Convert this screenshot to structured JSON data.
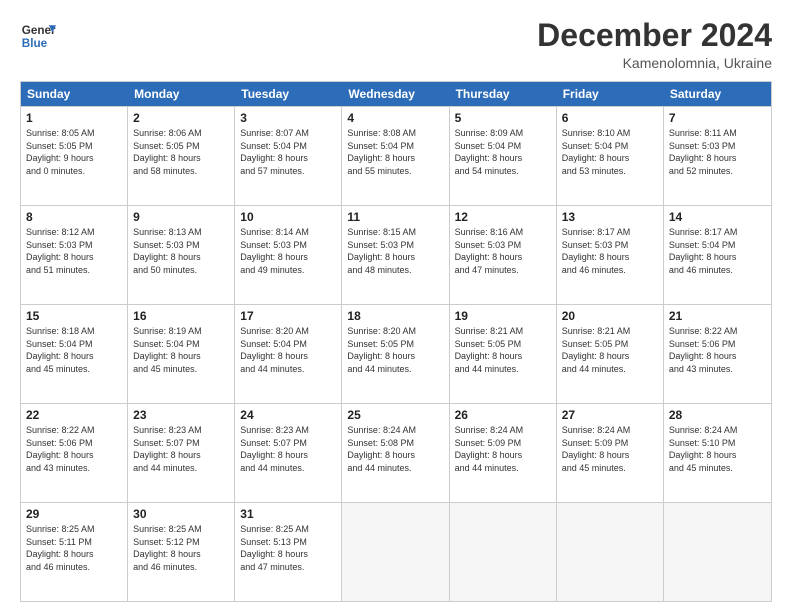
{
  "logo": {
    "line1": "General",
    "line2": "Blue"
  },
  "title": "December 2024",
  "subtitle": "Kamenolomnia, Ukraine",
  "days": [
    "Sunday",
    "Monday",
    "Tuesday",
    "Wednesday",
    "Thursday",
    "Friday",
    "Saturday"
  ],
  "weeks": [
    [
      {
        "day": "1",
        "info": "Sunrise: 8:05 AM\nSunset: 5:05 PM\nDaylight: 9 hours\nand 0 minutes."
      },
      {
        "day": "2",
        "info": "Sunrise: 8:06 AM\nSunset: 5:05 PM\nDaylight: 8 hours\nand 58 minutes."
      },
      {
        "day": "3",
        "info": "Sunrise: 8:07 AM\nSunset: 5:04 PM\nDaylight: 8 hours\nand 57 minutes."
      },
      {
        "day": "4",
        "info": "Sunrise: 8:08 AM\nSunset: 5:04 PM\nDaylight: 8 hours\nand 55 minutes."
      },
      {
        "day": "5",
        "info": "Sunrise: 8:09 AM\nSunset: 5:04 PM\nDaylight: 8 hours\nand 54 minutes."
      },
      {
        "day": "6",
        "info": "Sunrise: 8:10 AM\nSunset: 5:04 PM\nDaylight: 8 hours\nand 53 minutes."
      },
      {
        "day": "7",
        "info": "Sunrise: 8:11 AM\nSunset: 5:03 PM\nDaylight: 8 hours\nand 52 minutes."
      }
    ],
    [
      {
        "day": "8",
        "info": "Sunrise: 8:12 AM\nSunset: 5:03 PM\nDaylight: 8 hours\nand 51 minutes."
      },
      {
        "day": "9",
        "info": "Sunrise: 8:13 AM\nSunset: 5:03 PM\nDaylight: 8 hours\nand 50 minutes."
      },
      {
        "day": "10",
        "info": "Sunrise: 8:14 AM\nSunset: 5:03 PM\nDaylight: 8 hours\nand 49 minutes."
      },
      {
        "day": "11",
        "info": "Sunrise: 8:15 AM\nSunset: 5:03 PM\nDaylight: 8 hours\nand 48 minutes."
      },
      {
        "day": "12",
        "info": "Sunrise: 8:16 AM\nSunset: 5:03 PM\nDaylight: 8 hours\nand 47 minutes."
      },
      {
        "day": "13",
        "info": "Sunrise: 8:17 AM\nSunset: 5:03 PM\nDaylight: 8 hours\nand 46 minutes."
      },
      {
        "day": "14",
        "info": "Sunrise: 8:17 AM\nSunset: 5:04 PM\nDaylight: 8 hours\nand 46 minutes."
      }
    ],
    [
      {
        "day": "15",
        "info": "Sunrise: 8:18 AM\nSunset: 5:04 PM\nDaylight: 8 hours\nand 45 minutes."
      },
      {
        "day": "16",
        "info": "Sunrise: 8:19 AM\nSunset: 5:04 PM\nDaylight: 8 hours\nand 45 minutes."
      },
      {
        "day": "17",
        "info": "Sunrise: 8:20 AM\nSunset: 5:04 PM\nDaylight: 8 hours\nand 44 minutes."
      },
      {
        "day": "18",
        "info": "Sunrise: 8:20 AM\nSunset: 5:05 PM\nDaylight: 8 hours\nand 44 minutes."
      },
      {
        "day": "19",
        "info": "Sunrise: 8:21 AM\nSunset: 5:05 PM\nDaylight: 8 hours\nand 44 minutes."
      },
      {
        "day": "20",
        "info": "Sunrise: 8:21 AM\nSunset: 5:05 PM\nDaylight: 8 hours\nand 44 minutes."
      },
      {
        "day": "21",
        "info": "Sunrise: 8:22 AM\nSunset: 5:06 PM\nDaylight: 8 hours\nand 43 minutes."
      }
    ],
    [
      {
        "day": "22",
        "info": "Sunrise: 8:22 AM\nSunset: 5:06 PM\nDaylight: 8 hours\nand 43 minutes."
      },
      {
        "day": "23",
        "info": "Sunrise: 8:23 AM\nSunset: 5:07 PM\nDaylight: 8 hours\nand 44 minutes."
      },
      {
        "day": "24",
        "info": "Sunrise: 8:23 AM\nSunset: 5:07 PM\nDaylight: 8 hours\nand 44 minutes."
      },
      {
        "day": "25",
        "info": "Sunrise: 8:24 AM\nSunset: 5:08 PM\nDaylight: 8 hours\nand 44 minutes."
      },
      {
        "day": "26",
        "info": "Sunrise: 8:24 AM\nSunset: 5:09 PM\nDaylight: 8 hours\nand 44 minutes."
      },
      {
        "day": "27",
        "info": "Sunrise: 8:24 AM\nSunset: 5:09 PM\nDaylight: 8 hours\nand 45 minutes."
      },
      {
        "day": "28",
        "info": "Sunrise: 8:24 AM\nSunset: 5:10 PM\nDaylight: 8 hours\nand 45 minutes."
      }
    ],
    [
      {
        "day": "29",
        "info": "Sunrise: 8:25 AM\nSunset: 5:11 PM\nDaylight: 8 hours\nand 46 minutes."
      },
      {
        "day": "30",
        "info": "Sunrise: 8:25 AM\nSunset: 5:12 PM\nDaylight: 8 hours\nand 46 minutes."
      },
      {
        "day": "31",
        "info": "Sunrise: 8:25 AM\nSunset: 5:13 PM\nDaylight: 8 hours\nand 47 minutes."
      },
      {
        "day": "",
        "info": ""
      },
      {
        "day": "",
        "info": ""
      },
      {
        "day": "",
        "info": ""
      },
      {
        "day": "",
        "info": ""
      }
    ]
  ]
}
